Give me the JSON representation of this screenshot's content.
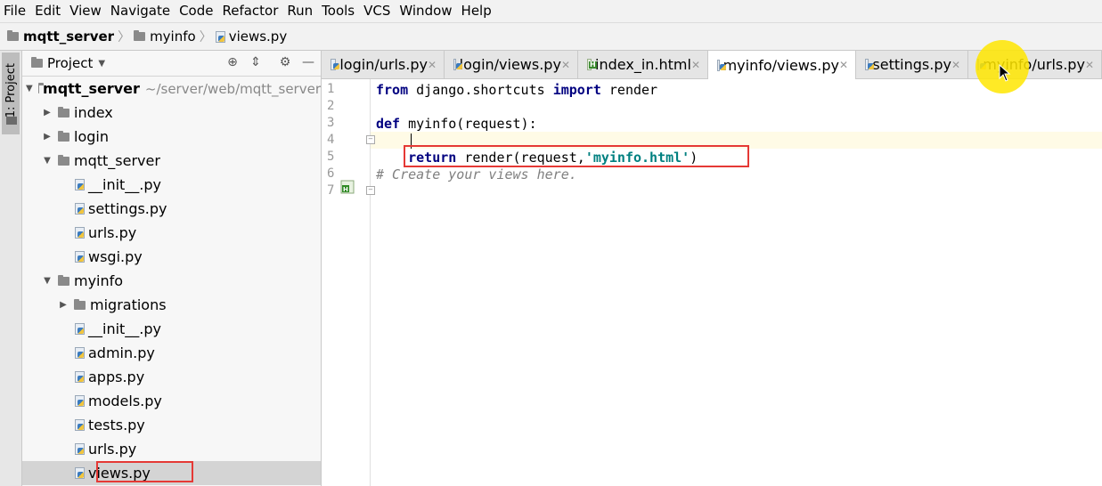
{
  "menu": [
    "File",
    "Edit",
    "View",
    "Navigate",
    "Code",
    "Refactor",
    "Run",
    "Tools",
    "VCS",
    "Window",
    "Help"
  ],
  "breadcrumb": {
    "project": "mqtt_server",
    "folder": "myinfo",
    "file": "views.py"
  },
  "sidebar": {
    "tab_label": "1: Project"
  },
  "project_panel": {
    "title": "Project",
    "root_name": "mqtt_server",
    "root_path": "~/server/web/mqtt_server",
    "items": [
      {
        "label": "index",
        "kind": "folder",
        "depth": 1,
        "expanded": false
      },
      {
        "label": "login",
        "kind": "folder",
        "depth": 1,
        "expanded": false
      },
      {
        "label": "mqtt_server",
        "kind": "folder",
        "depth": 1,
        "expanded": true
      },
      {
        "label": "__init__.py",
        "kind": "py",
        "depth": 2
      },
      {
        "label": "settings.py",
        "kind": "py",
        "depth": 2
      },
      {
        "label": "urls.py",
        "kind": "py",
        "depth": 2
      },
      {
        "label": "wsgi.py",
        "kind": "py",
        "depth": 2
      },
      {
        "label": "myinfo",
        "kind": "folder",
        "depth": 1,
        "expanded": true
      },
      {
        "label": "migrations",
        "kind": "folder",
        "depth": 2,
        "expanded": false
      },
      {
        "label": "__init__.py",
        "kind": "py",
        "depth": 2
      },
      {
        "label": "admin.py",
        "kind": "py",
        "depth": 2
      },
      {
        "label": "apps.py",
        "kind": "py",
        "depth": 2
      },
      {
        "label": "models.py",
        "kind": "py",
        "depth": 2
      },
      {
        "label": "tests.py",
        "kind": "py",
        "depth": 2
      },
      {
        "label": "urls.py",
        "kind": "py",
        "depth": 2
      },
      {
        "label": "views.py",
        "kind": "py",
        "depth": 2,
        "selected": true
      }
    ]
  },
  "tabs": [
    {
      "label": "login/urls.py",
      "icon": "py",
      "active": false
    },
    {
      "label": "login/views.py",
      "icon": "py",
      "active": false
    },
    {
      "label": "index_in.html",
      "icon": "html",
      "active": false
    },
    {
      "label": "myinfo/views.py",
      "icon": "py",
      "active": true
    },
    {
      "label": "settings.py",
      "icon": "py",
      "active": false
    },
    {
      "label": "myinfo/urls.py",
      "icon": "py",
      "active": false
    }
  ],
  "code": {
    "line_numbers": [
      "1",
      "2",
      "3",
      "4",
      "5",
      "6",
      "7"
    ],
    "l1": {
      "kw1": "from",
      "mid": " django.shortcuts ",
      "kw2": "import",
      "rest": " render"
    },
    "l3": {
      "kw": "def",
      "rest": " myinfo(request):"
    },
    "l5": {
      "indent": "    ",
      "kw": "return",
      "mid": " render(request,",
      "str": "'myinfo.html'",
      "end": ")"
    },
    "l6": {
      "comment": "# Create your views here."
    }
  },
  "colors": {
    "keyword": "#000080",
    "string": "#008080",
    "comment": "#808080",
    "highlight_box": "#e53935",
    "current_line": "#fffbe6"
  }
}
